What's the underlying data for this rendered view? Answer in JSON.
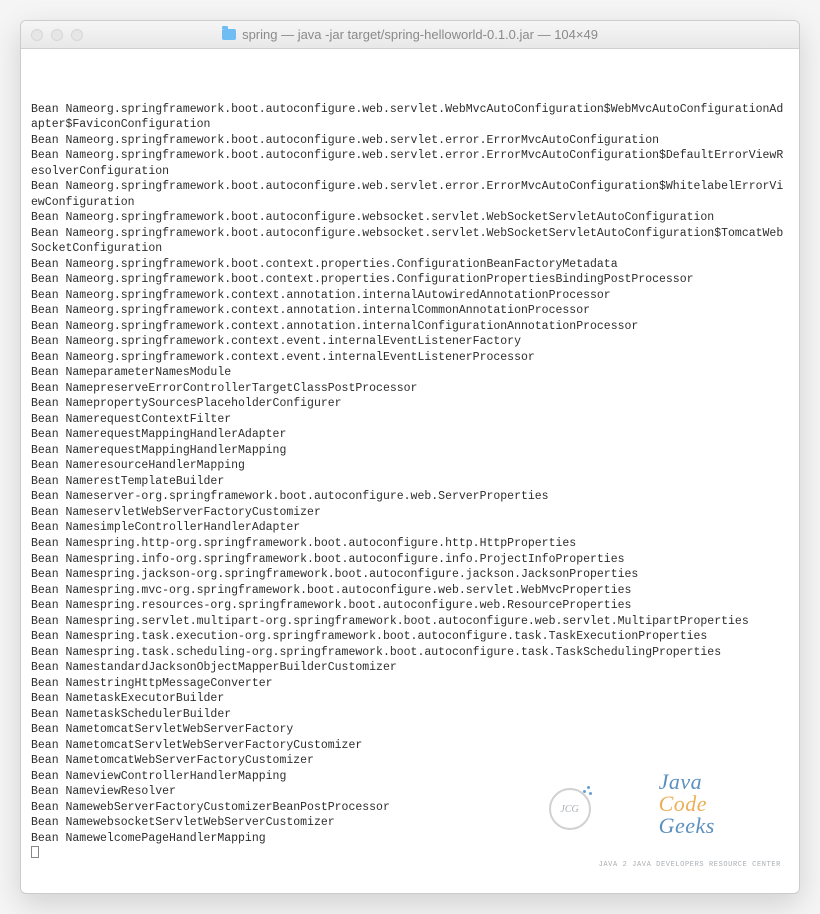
{
  "title": "spring — java -jar target/spring-helloworld-0.1.0.jar — 104×49",
  "lines": [
    "Bean Nameorg.springframework.boot.autoconfigure.web.servlet.WebMvcAutoConfiguration$WebMvcAutoConfigurationAdapter$FaviconConfiguration",
    "Bean Nameorg.springframework.boot.autoconfigure.web.servlet.error.ErrorMvcAutoConfiguration",
    "Bean Nameorg.springframework.boot.autoconfigure.web.servlet.error.ErrorMvcAutoConfiguration$DefaultErrorViewResolverConfiguration",
    "Bean Nameorg.springframework.boot.autoconfigure.web.servlet.error.ErrorMvcAutoConfiguration$WhitelabelErrorViewConfiguration",
    "Bean Nameorg.springframework.boot.autoconfigure.websocket.servlet.WebSocketServletAutoConfiguration",
    "Bean Nameorg.springframework.boot.autoconfigure.websocket.servlet.WebSocketServletAutoConfiguration$TomcatWebSocketConfiguration",
    "Bean Nameorg.springframework.boot.context.properties.ConfigurationBeanFactoryMetadata",
    "Bean Nameorg.springframework.boot.context.properties.ConfigurationPropertiesBindingPostProcessor",
    "Bean Nameorg.springframework.context.annotation.internalAutowiredAnnotationProcessor",
    "Bean Nameorg.springframework.context.annotation.internalCommonAnnotationProcessor",
    "Bean Nameorg.springframework.context.annotation.internalConfigurationAnnotationProcessor",
    "Bean Nameorg.springframework.context.event.internalEventListenerFactory",
    "Bean Nameorg.springframework.context.event.internalEventListenerProcessor",
    "Bean NameparameterNamesModule",
    "Bean NamepreserveErrorControllerTargetClassPostProcessor",
    "Bean NamepropertySourcesPlaceholderConfigurer",
    "Bean NamerequestContextFilter",
    "Bean NamerequestMappingHandlerAdapter",
    "Bean NamerequestMappingHandlerMapping",
    "Bean NameresourceHandlerMapping",
    "Bean NamerestTemplateBuilder",
    "Bean Nameserver-org.springframework.boot.autoconfigure.web.ServerProperties",
    "Bean NameservletWebServerFactoryCustomizer",
    "Bean NamesimpleControllerHandlerAdapter",
    "Bean Namespring.http-org.springframework.boot.autoconfigure.http.HttpProperties",
    "Bean Namespring.info-org.springframework.boot.autoconfigure.info.ProjectInfoProperties",
    "Bean Namespring.jackson-org.springframework.boot.autoconfigure.jackson.JacksonProperties",
    "Bean Namespring.mvc-org.springframework.boot.autoconfigure.web.servlet.WebMvcProperties",
    "Bean Namespring.resources-org.springframework.boot.autoconfigure.web.ResourceProperties",
    "Bean Namespring.servlet.multipart-org.springframework.boot.autoconfigure.web.servlet.MultipartProperties",
    "Bean Namespring.task.execution-org.springframework.boot.autoconfigure.task.TaskExecutionProperties",
    "Bean Namespring.task.scheduling-org.springframework.boot.autoconfigure.task.TaskSchedulingProperties",
    "Bean NamestandardJacksonObjectMapperBuilderCustomizer",
    "Bean NamestringHttpMessageConverter",
    "Bean NametaskExecutorBuilder",
    "Bean NametaskSchedulerBuilder",
    "Bean NametomcatServletWebServerFactory",
    "Bean NametomcatServletWebServerFactoryCustomizer",
    "Bean NametomcatWebServerFactoryCustomizer",
    "Bean NameviewControllerHandlerMapping",
    "Bean NameviewResolver",
    "Bean NamewebServerFactoryCustomizerBeanPostProcessor",
    "Bean NamewebsocketServletWebServerCustomizer",
    "Bean NamewelcomePageHandlerMapping"
  ],
  "watermark": {
    "circle": "JCG",
    "java": "Java",
    "code": "Code",
    "geeks": "Geeks",
    "sub": "JAVA 2 JAVA DEVELOPERS RESOURCE CENTER"
  }
}
